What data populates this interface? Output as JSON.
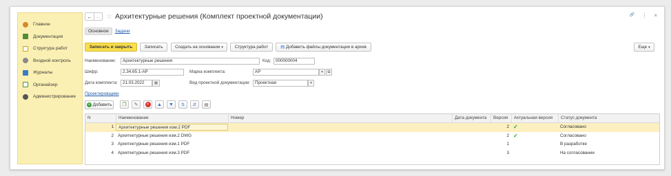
{
  "sidebar": {
    "items": [
      {
        "label": "Главное",
        "icon": "home-icon",
        "color": "#d48a2a"
      },
      {
        "label": "Документация",
        "icon": "document-icon",
        "color": "#4e8f3a"
      },
      {
        "label": "Структура работ",
        "icon": "structure-icon",
        "color": "#c9a021"
      },
      {
        "label": "Входной контроль",
        "icon": "gear-check-icon",
        "color": "#6b6b6b"
      },
      {
        "label": "Журналы",
        "icon": "journal-icon",
        "color": "#3c7bc4"
      },
      {
        "label": "Органайзер",
        "icon": "organizer-icon",
        "color": "#4e8f3a"
      },
      {
        "label": "Администрирование",
        "icon": "settings-icon",
        "color": "#555555"
      }
    ]
  },
  "window": {
    "title": "Архитектурные решения (Комплект проектной документации)",
    "back": "←",
    "forward": "→",
    "link_icon": "🔗",
    "menu_icon": "⋮",
    "close_icon": "×"
  },
  "tabs": {
    "main": "Основное",
    "tasks": "Задачи"
  },
  "toolbar": {
    "save_close": "Записать и закрыть",
    "save": "Записать",
    "create_based": "Создать на основании",
    "work_structure": "Структура работ",
    "add_files": "Добавить файлы документации в архив",
    "more": "Еще"
  },
  "form": {
    "name_label": "Наименование:",
    "name_value": "Архитектурные решения",
    "code_label": "Код:",
    "code_value": "000000004",
    "cipher_label": "Шифр:",
    "cipher_value": "2.34.65.1-АР",
    "mark_label": "Марка комплекта:",
    "mark_value": "АР",
    "date_label": "Дата комплекта:",
    "date_value": "21.03.2022",
    "doctype_label": "Вид проектной документации:",
    "doctype_value": "Проектная",
    "designers_link": "Проектировщики"
  },
  "table_toolbar": {
    "add": "Добавить"
  },
  "table": {
    "columns": [
      "N",
      "Наименование",
      "Номер",
      "Дата документа",
      "Версия",
      "Актуальная версия",
      "Статус документа"
    ],
    "rows": [
      {
        "n": "1",
        "name": "Архитектурные решения изм.2 PDF",
        "number": "",
        "date": "",
        "version": "2",
        "actual": "✓",
        "status": "Согласовано"
      },
      {
        "n": "2",
        "name": "Архитектурные решения изм.2 DWG",
        "number": "",
        "date": "",
        "version": "2",
        "actual": "✓",
        "status": "Согласовано"
      },
      {
        "n": "3",
        "name": "Архитектурные решения изм.1 PDF",
        "number": "",
        "date": "",
        "version": "1",
        "actual": "",
        "status": "В разработке"
      },
      {
        "n": "4",
        "name": "Архитектурные решения изм.3 PDF",
        "number": "",
        "date": "",
        "version": "3",
        "actual": "",
        "status": "На согласовании"
      }
    ]
  }
}
